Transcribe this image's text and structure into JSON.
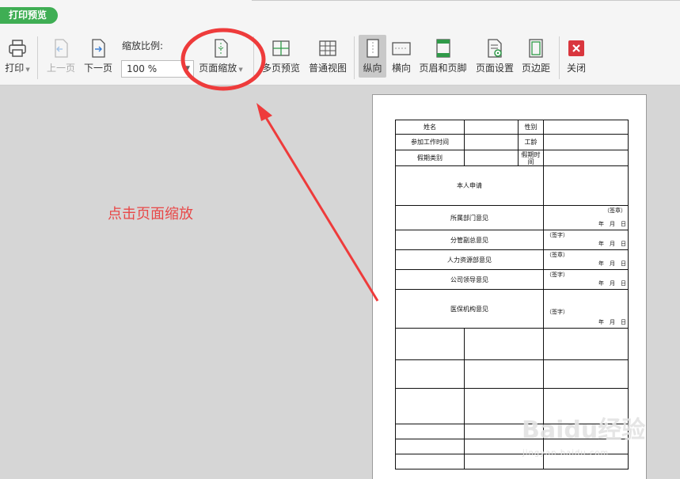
{
  "tab_title": "打印预览",
  "toolbar": {
    "print": "打印",
    "prev_page": "上一页",
    "next_page": "下一页",
    "zoom_label": "缩放比例:",
    "zoom_value": "100 %",
    "page_scale": "页面缩放",
    "multi_page": "多页预览",
    "normal_view": "普通视图",
    "portrait": "纵向",
    "landscape": "横向",
    "header_footer": "页眉和页脚",
    "page_setup": "页面设置",
    "margins": "页边距",
    "close": "关闭"
  },
  "annotation": "点击页面缩放",
  "form": {
    "name": "姓名",
    "gender": "性别",
    "work_start": "参加工作时间",
    "age": "工龄",
    "leave_type": "假期类别",
    "leave_time": "假期时间",
    "applicant": "本人申请",
    "dept_opinion": "所属部门意见",
    "vp_opinion": "分管副总意见",
    "hr_opinion": "人力资源部意见",
    "leader_opinion": "公司领导意见",
    "insurance_opinion": "医保机构意见",
    "sign": "（签字）",
    "sign_seal": "（签章）",
    "date_line": "年　月　日"
  },
  "watermark": "Baidu经验",
  "watermark_url": "jingyan.baidu.com",
  "colors": {
    "tab_green": "#3fae54",
    "annotation_red": "#e84848",
    "close_red": "#d9363e"
  }
}
